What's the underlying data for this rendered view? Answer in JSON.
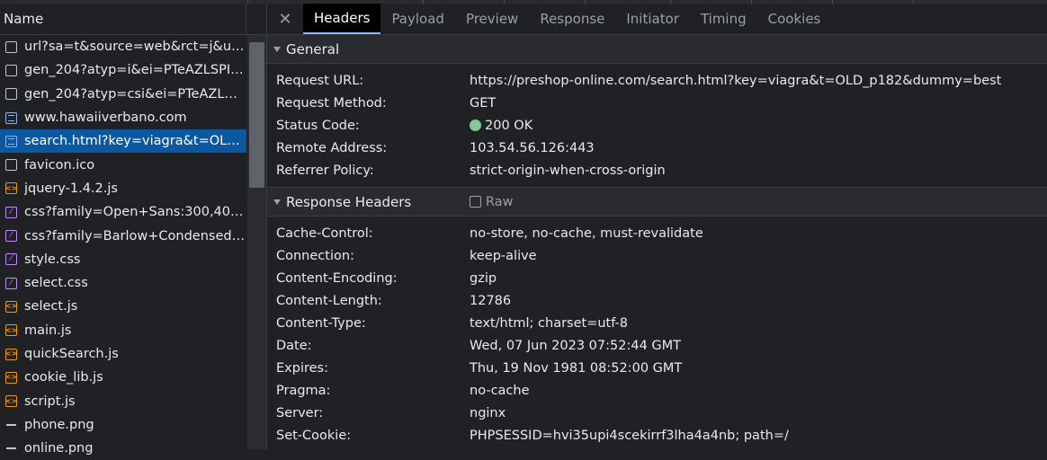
{
  "request_list": {
    "header": "Name",
    "items": [
      {
        "name": "url?sa=t&source=web&rct=j&url=...",
        "type": "plain",
        "selected": false
      },
      {
        "name": "gen_204?atyp=i&ei=PTeAZLSPItyF...",
        "type": "plain",
        "selected": false
      },
      {
        "name": "gen_204?atyp=csi&ei=PTeAZLSPIty...",
        "type": "plain",
        "selected": false
      },
      {
        "name": "www.hawaiiverbano.com",
        "type": "doc",
        "selected": false
      },
      {
        "name": "search.html?key=viagra&t=OLD_p1...",
        "type": "doc",
        "selected": true
      },
      {
        "name": "favicon.ico",
        "type": "plain",
        "selected": false
      },
      {
        "name": "jquery-1.4.2.js",
        "type": "js",
        "selected": false
      },
      {
        "name": "css?family=Open+Sans:300,400,600",
        "type": "css",
        "selected": false
      },
      {
        "name": "css?family=Barlow+Condensed:300...",
        "type": "css",
        "selected": false
      },
      {
        "name": "style.css",
        "type": "css",
        "selected": false
      },
      {
        "name": "select.css",
        "type": "css",
        "selected": false
      },
      {
        "name": "select.js",
        "type": "js",
        "selected": false
      },
      {
        "name": "main.js",
        "type": "js",
        "selected": false
      },
      {
        "name": "quickSearch.js",
        "type": "js",
        "selected": false
      },
      {
        "name": "cookie_lib.js",
        "type": "js",
        "selected": false
      },
      {
        "name": "script.js",
        "type": "js",
        "selected": false
      },
      {
        "name": "phone.png",
        "type": "img",
        "selected": false
      },
      {
        "name": "online.png",
        "type": "img",
        "selected": false
      }
    ]
  },
  "tabs": {
    "close_icon": "close-icon",
    "items": [
      "Headers",
      "Payload",
      "Preview",
      "Response",
      "Initiator",
      "Timing",
      "Cookies"
    ],
    "active": "Headers"
  },
  "general": {
    "title": "General",
    "rows": [
      {
        "key": "Request URL:",
        "value": "https://preshop-online.com/search.html?key=viagra&t=OLD_p182&dummy=best"
      },
      {
        "key": "Request Method:",
        "value": "GET"
      },
      {
        "key": "Status Code:",
        "value": "200 OK",
        "status_color": "#81c995"
      },
      {
        "key": "Remote Address:",
        "value": "103.54.56.126:443"
      },
      {
        "key": "Referrer Policy:",
        "value": "strict-origin-when-cross-origin"
      }
    ]
  },
  "response_headers": {
    "title": "Response Headers",
    "raw_label": "Raw",
    "raw_checked": false,
    "rows": [
      {
        "key": "Cache-Control:",
        "value": "no-store, no-cache, must-revalidate"
      },
      {
        "key": "Connection:",
        "value": "keep-alive"
      },
      {
        "key": "Content-Encoding:",
        "value": "gzip"
      },
      {
        "key": "Content-Length:",
        "value": "12786"
      },
      {
        "key": "Content-Type:",
        "value": "text/html; charset=utf-8"
      },
      {
        "key": "Date:",
        "value": "Wed, 07 Jun 2023 07:52:44 GMT"
      },
      {
        "key": "Expires:",
        "value": "Thu, 19 Nov 1981 08:52:00 GMT"
      },
      {
        "key": "Pragma:",
        "value": "no-cache"
      },
      {
        "key": "Server:",
        "value": "nginx"
      },
      {
        "key": "Set-Cookie:",
        "value": "PHPSESSID=hvi35upi4scekirrf3lha4a4nb; path=/"
      }
    ]
  },
  "colors": {
    "selected_row": "#0b57a0",
    "active_tab_underline": "#8ab4f8",
    "js_icon": "#f29900",
    "css_icon": "#c58af9",
    "doc_icon": "#8ab4f8"
  }
}
